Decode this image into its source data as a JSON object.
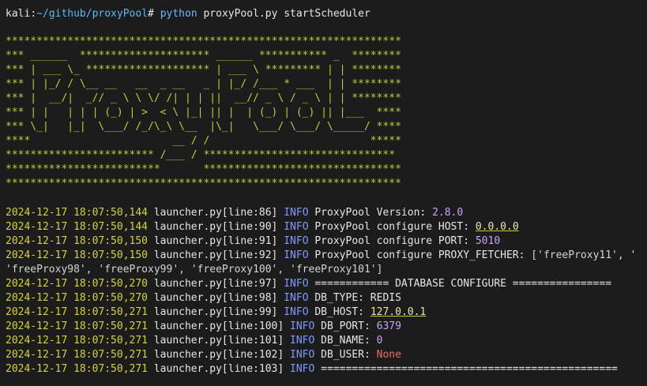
{
  "prompt": {
    "user": "kali",
    "sep": ":",
    "path": "~/github/proxyPool",
    "hash": "# ",
    "command": "python",
    "args": " proxyPool.py startScheduler"
  },
  "banner": [
    "****************************************************************",
    "*** ______  ********************* ______ *********** _  ********",
    "*** | ___ \\_ ******************** | ___ \\ ********* | | ********",
    "*** | |_/ / \\__ __   __  _ __   _ | |_/ /___ * ___  | | ********",
    "*** |  __/|  _// _ \\ \\ \\/ /| | | ||  __// _ \\ / _ \\ | | ********",
    "*** | |   | | | (_) | >  < \\ |_| || |  | (_) | (_) || |___  ****",
    "*** \\_|   |_|  \\___/ /_/\\_\\ \\__  |\\_|   \\___/ \\___/ \\_____/ ****",
    "****                       __ / /                          *****",
    "************************ /___ / *******************************",
    "*************************       ********************************",
    "****************************************************************"
  ],
  "logs": [
    {
      "ts": "2024-12-17 18:07:50,144",
      "src": " launcher.py[line:86]",
      "level": "INFO",
      "msg": " ProxyPool Version: ",
      "val": "2.8.0",
      "val_style": "num"
    },
    {
      "ts": "2024-12-17 18:07:50,144",
      "src": " launcher.py[line:90]",
      "level": "INFO",
      "msg": " ProxyPool configure HOST: ",
      "val": "0.0.0.0",
      "val_style": "ul"
    },
    {
      "ts": "2024-12-17 18:07:50,150",
      "src": " launcher.py[line:91]",
      "level": "INFO",
      "msg": " ProxyPool configure PORT: ",
      "val": "5010",
      "val_style": "num"
    },
    {
      "ts": "2024-12-17 18:07:50,150",
      "src": " launcher.py[line:92]",
      "level": "INFO",
      "msg": " ProxyPool configure PROXY_FETCHER: ",
      "val": "['freeProxy11', '",
      "val_style": "str"
    },
    {
      "ts": "",
      "src": "",
      "level": "",
      "msg": "",
      "val": "'freeProxy98', 'freeProxy99', 'freeProxy100', 'freeProxy101']",
      "val_style": "str"
    },
    {
      "ts": "2024-12-17 18:07:50,270",
      "src": " launcher.py[line:97]",
      "level": "INFO",
      "msg": " ============ DATABASE CONFIGURE ================",
      "val": "",
      "val_style": "str"
    },
    {
      "ts": "2024-12-17 18:07:50,270",
      "src": " launcher.py[line:98]",
      "level": "INFO",
      "msg": " DB_TYPE: REDIS",
      "val": "",
      "val_style": "str"
    },
    {
      "ts": "2024-12-17 18:07:50,271",
      "src": " launcher.py[line:99]",
      "level": "INFO",
      "msg": " DB_HOST: ",
      "val": "127.0.0.1",
      "val_style": "ul"
    },
    {
      "ts": "2024-12-17 18:07:50,271",
      "src": " launcher.py[line:100]",
      "level": "INFO",
      "msg": " DB_PORT: ",
      "val": "6379",
      "val_style": "num"
    },
    {
      "ts": "2024-12-17 18:07:50,271",
      "src": " launcher.py[line:101]",
      "level": "INFO",
      "msg": " DB_NAME: ",
      "val": "0",
      "val_style": "num"
    },
    {
      "ts": "2024-12-17 18:07:50,271",
      "src": " launcher.py[line:102]",
      "level": "INFO",
      "msg": " DB_USER: ",
      "val": "None",
      "val_style": "none"
    },
    {
      "ts": "2024-12-17 18:07:50,271",
      "src": " launcher.py[line:103]",
      "level": "INFO",
      "msg": " ================================================",
      "val": "",
      "val_style": "str"
    }
  ],
  "colors": {
    "background": "#1c1c1c",
    "banner": "#b5d334",
    "timestamp": "#d6d23a",
    "info": "#7f9bff",
    "number": "#c9a3ff",
    "none": "#f06a6a"
  }
}
